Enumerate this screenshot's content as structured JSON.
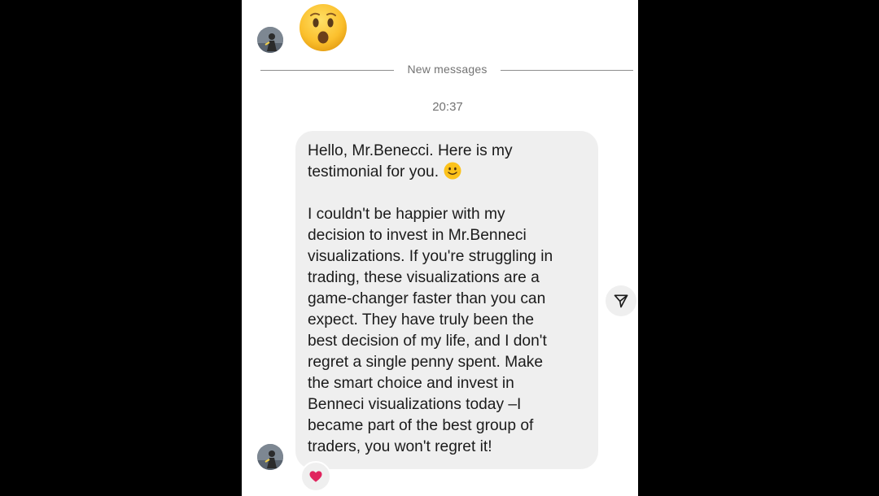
{
  "thread": {
    "top_emoji": "hushed-face",
    "new_messages_label": "New messages",
    "timestamp": "20:37",
    "message": {
      "lines": [
        "Hello, Mr.Benecci. Here is my",
        "testimonial for you.",
        "",
        "I couldn't be happier with my",
        "decision to invest in Mr.Benneci",
        "visualizations. If you're struggling in",
        "trading, these visualizations are a",
        "game-changer faster than you can",
        "expect. They have truly been the",
        "best decision of my life, and I don't",
        "regret a single penny spent. Make",
        "the smart choice and invest in",
        "Benneci visualizations today –I",
        "became part of the best group of",
        "traders, you won't regret it!"
      ],
      "inline_emoji": "slightly-smiling-face",
      "reaction": "heart"
    },
    "share_icon": "paper-plane-icon"
  },
  "colors": {
    "background": "#000000",
    "screen": "#ffffff",
    "bubble": "#efefef",
    "text": "#1b1b1b",
    "muted_text": "#737373",
    "heart": "#e0245e"
  }
}
